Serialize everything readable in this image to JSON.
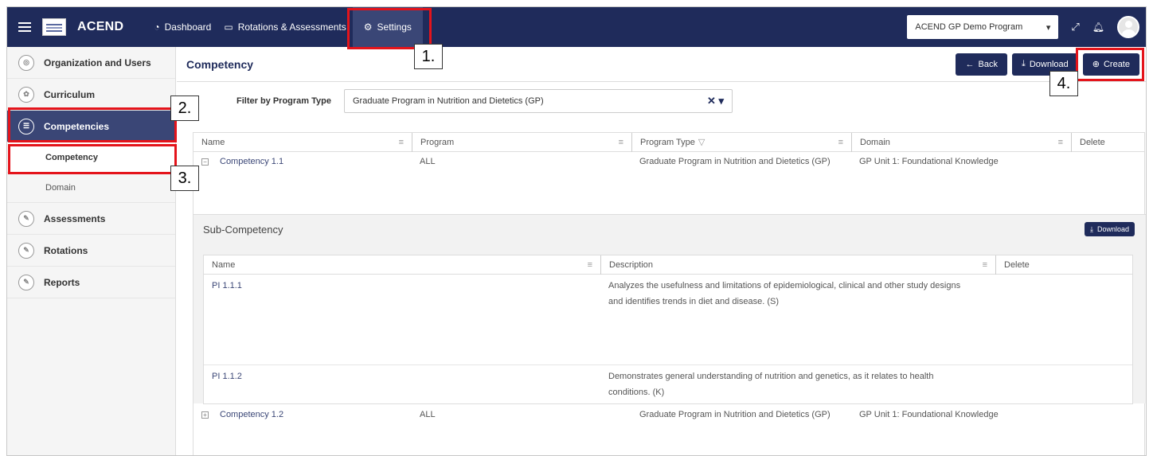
{
  "nav": {
    "brand": "ACEND",
    "items": [
      {
        "label": "Dashboard",
        "icon": "dashboard-icon"
      },
      {
        "label": "Rotations & Assessments",
        "icon": "monitor-icon"
      },
      {
        "label": "Settings",
        "icon": "gear-icon"
      }
    ],
    "program_select": "ACEND GP Demo Program"
  },
  "sidebar": {
    "items": [
      {
        "label": "Organization and Users"
      },
      {
        "label": "Curriculum"
      },
      {
        "label": "Competencies"
      },
      {
        "label": "Assessments"
      },
      {
        "label": "Rotations"
      },
      {
        "label": "Reports"
      }
    ],
    "subitems": [
      {
        "label": "Competency"
      },
      {
        "label": "Domain"
      }
    ]
  },
  "page": {
    "title": "Competency",
    "back_label": "Back",
    "download_label": "Download",
    "create_label": "Create"
  },
  "filter": {
    "label": "Filter by Program Type",
    "value": "Graduate Program in Nutrition and Dietetics (GP)"
  },
  "grid": {
    "columns": [
      "Name",
      "Program",
      "Program Type",
      "Domain",
      "Delete"
    ],
    "rows": [
      {
        "name": "Competency 1.1",
        "program": "ALL",
        "program_type": "Graduate Program in Nutrition and Dietetics (GP)",
        "domain": "GP Unit 1: Foundational Knowledge"
      },
      {
        "name": "Competency 1.2",
        "program": "ALL",
        "program_type": "Graduate Program in Nutrition and Dietetics (GP)",
        "domain": "GP Unit 1: Foundational Knowledge"
      }
    ]
  },
  "sub": {
    "title": "Sub-Competency",
    "download_label": "Download",
    "columns": [
      "Name",
      "Description",
      "Delete"
    ],
    "rows": [
      {
        "name": "PI 1.1.1",
        "desc_line1": "Analyzes the usefulness and limitations of epidemiological, clinical and other study designs",
        "desc_line2": "and identifies trends in diet and disease. (S)"
      },
      {
        "name": "PI 1.1.2",
        "desc_line1": "Demonstrates general understanding of nutrition and genetics, as it relates to health",
        "desc_line2": "conditions. (K)"
      }
    ]
  },
  "callouts": [
    "1.",
    "2.",
    "3.",
    "4."
  ],
  "colors": {
    "navy": "#1f2b5b",
    "accent_active": "#3a4676",
    "annotation_red": "#e4141b"
  }
}
